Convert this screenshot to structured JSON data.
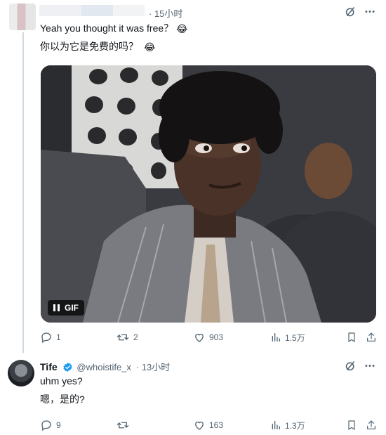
{
  "post1": {
    "time": "· 15小时",
    "text_en": "Yeah you thought it was free？",
    "text_zh": "你以为它是免费的吗？",
    "emoji": "😂",
    "media": {
      "badge_label": "GIF",
      "pause_icon": "pause-icon"
    },
    "actions": {
      "reply_count": "1",
      "repost_count": "2",
      "like_count": "903",
      "views_count": "1.5万"
    }
  },
  "post2": {
    "name": "Tife",
    "handle": "@whoistife_x",
    "time": "· 13小时",
    "text_en": "uhm yes?",
    "text_zh": "嗯，是的?",
    "actions": {
      "reply_count": "9",
      "repost_count": "",
      "like_count": "163",
      "views_count": "1.3万"
    }
  },
  "icons": [
    "grok-icon",
    "more-icon",
    "reply-icon",
    "repost-icon",
    "like-icon",
    "views-icon",
    "bookmark-icon",
    "share-icon",
    "verified-icon"
  ],
  "colors": {
    "text": "#0f1419",
    "muted": "#536471",
    "verified": "#1d9bf0",
    "divider": "#cfd9de"
  }
}
